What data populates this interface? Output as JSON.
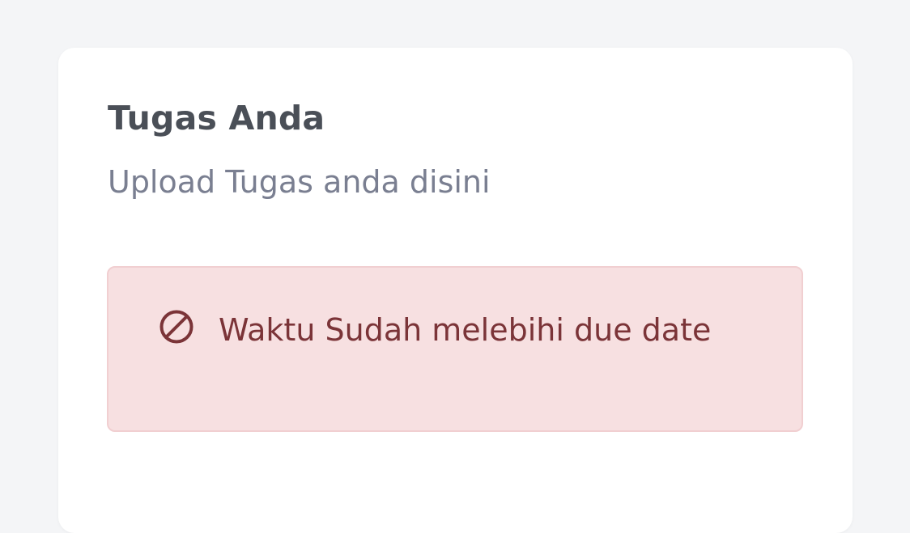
{
  "card": {
    "title": "Tugas Anda",
    "subtitle": "Upload Tugas anda disini"
  },
  "alert": {
    "icon": "ban-icon",
    "message": "Waktu Sudah melebihi due date",
    "colors": {
      "background": "#f7e0e1",
      "border": "#f1cfd1",
      "text": "#7b3438"
    }
  }
}
